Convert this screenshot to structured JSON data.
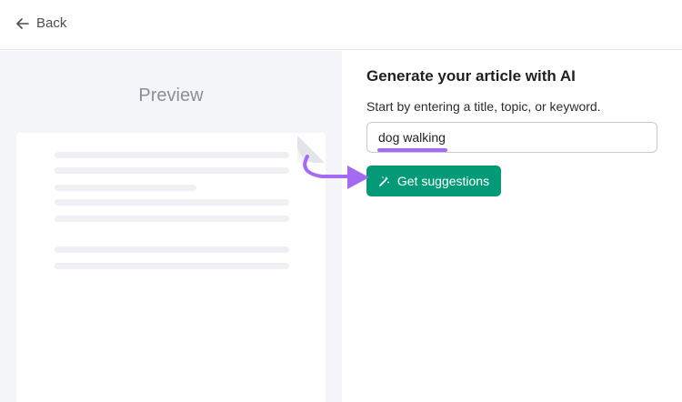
{
  "topbar": {
    "back_label": "Back",
    "back_icon": "arrow-left-icon"
  },
  "preview": {
    "title": "Preview"
  },
  "panel": {
    "heading": "Generate your article with AI",
    "subtext": "Start by entering a title, topic, or keyword.",
    "input_value": "dog walking",
    "button_label": "Get suggestions",
    "button_icon": "magic-wand-icon"
  },
  "colors": {
    "accent_green": "#049a78",
    "highlight_purple": "#a46bf0"
  }
}
